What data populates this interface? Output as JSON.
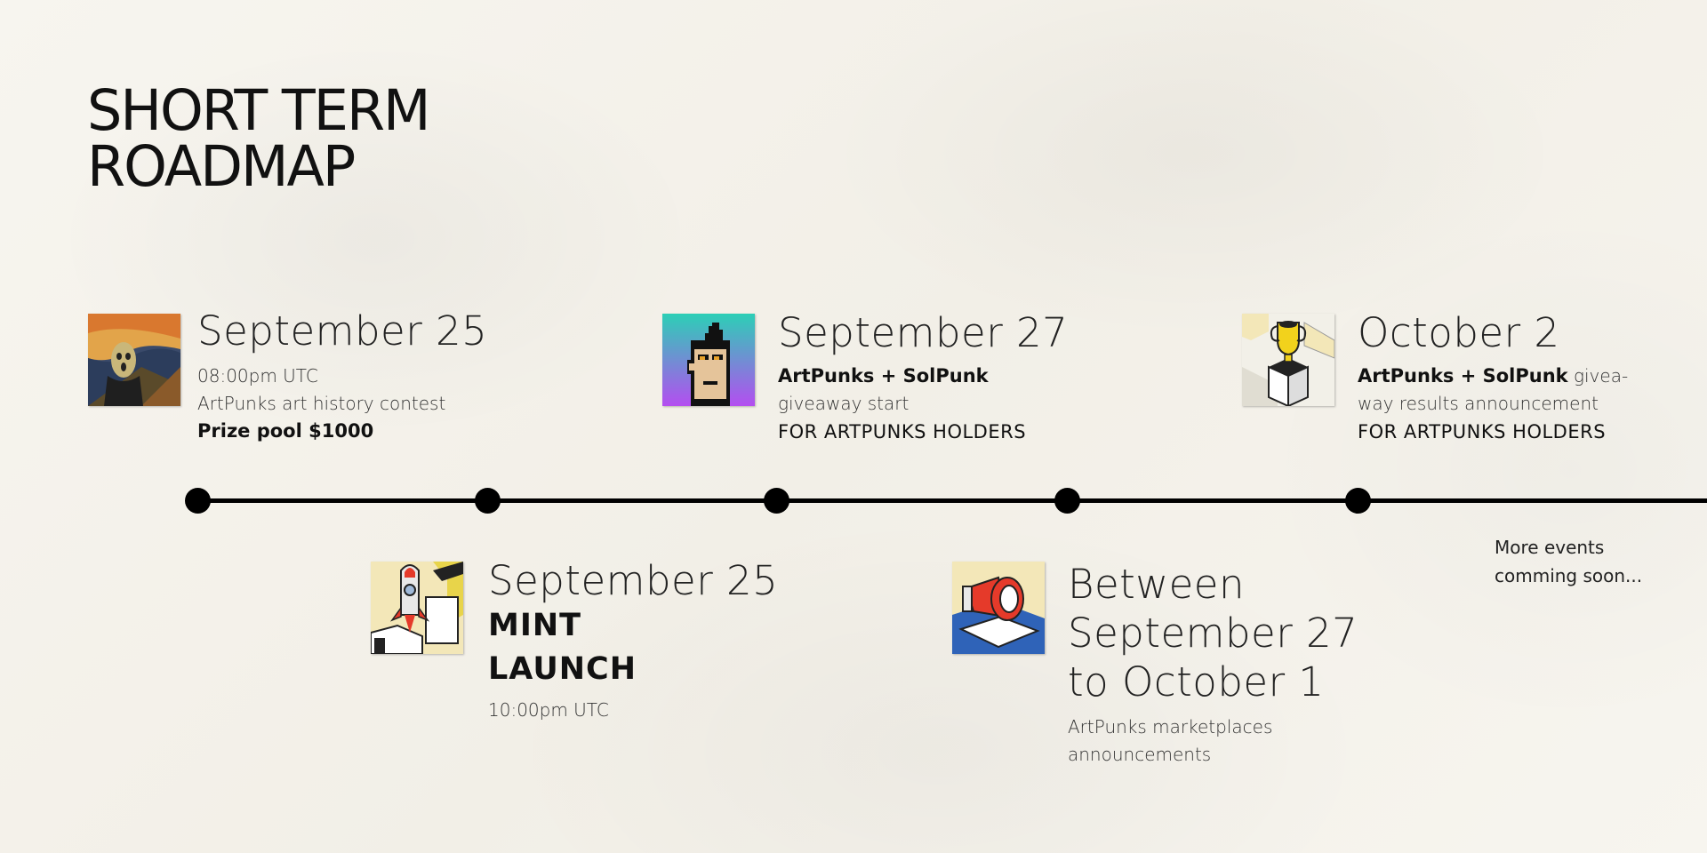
{
  "page": {
    "title_line1": "SHORT TERM",
    "title_line2": "ROADMAP"
  },
  "events": [
    {
      "date": "September 25",
      "time": "08:00pm UTC",
      "description": "ArtPunks art history contest",
      "highlight": "Prize pool $1000",
      "icon": "scream-painting-icon"
    },
    {
      "date": "September 25",
      "headline_line1": "MINT",
      "headline_line2": "LAUNCH",
      "time": "10:00pm UTC",
      "icon": "rocket-icon"
    },
    {
      "date": "September 27",
      "partners": "ArtPunks + SolPunk",
      "description": "giveaway start",
      "audience": "FOR ARTPUNKS HOLDERS",
      "icon": "pixel-punk-icon"
    },
    {
      "date_line1": "Between",
      "date_line2": "September 27",
      "date_line3": "to October 1",
      "description_line1": "ArtPunks marketplaces",
      "description_line2": "announcements",
      "icon": "megaphone-icon"
    },
    {
      "date": "October 2",
      "partners": "ArtPunks + SolPunk",
      "description_line1_rest": " givea-",
      "description_line2": "way results announcement",
      "audience": "FOR ARTPUNKS HOLDERS",
      "icon": "trophy-icon"
    }
  ],
  "more_events": {
    "line1": "More events",
    "line2": "comming soon..."
  },
  "colors": {
    "background": "#f6f4ee",
    "ink": "#000000"
  }
}
